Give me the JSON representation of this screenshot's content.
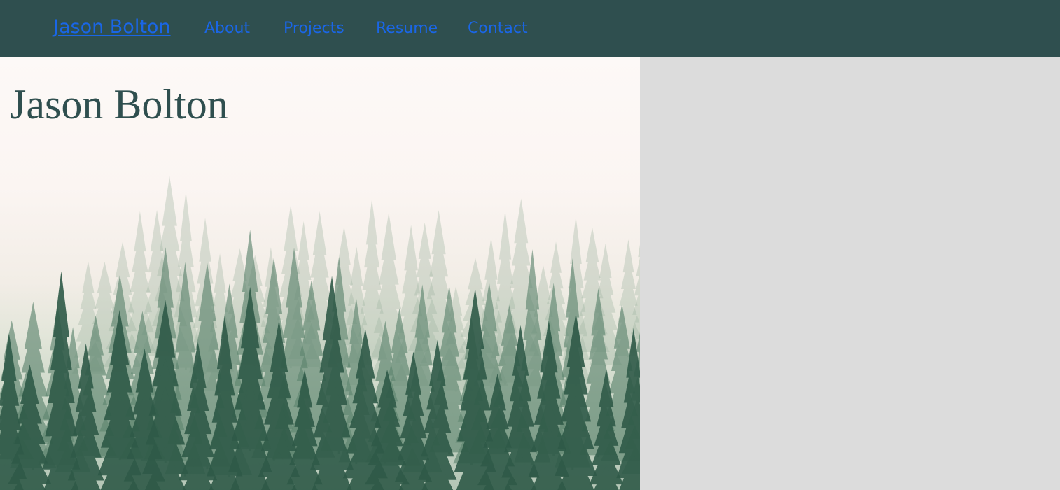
{
  "nav": {
    "brand": "Jason Bolton",
    "links": [
      {
        "label": "About"
      },
      {
        "label": "Projects"
      },
      {
        "label": "Resume"
      },
      {
        "label": "Contact"
      }
    ]
  },
  "hero": {
    "title": "Jason Bolton",
    "image": "misty-pine-forest"
  },
  "colors": {
    "navbar_bg": "#2f4f4f",
    "link": "#1a66e6",
    "title": "#2f4f4f",
    "side_panel_bg": "#dcdcdc"
  }
}
